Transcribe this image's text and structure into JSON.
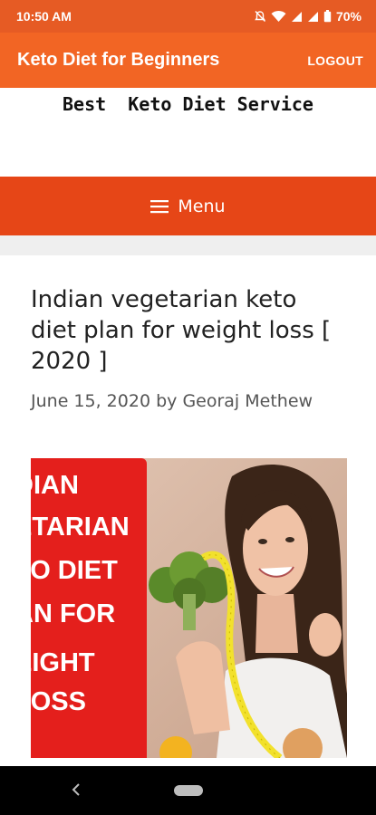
{
  "status_bar": {
    "time": "10:50 AM",
    "battery": "70%",
    "icons": [
      "mute-icon",
      "wifi-icon",
      "signal-icon",
      "signal-icon",
      "battery-icon"
    ]
  },
  "app_bar": {
    "title": "Keto Diet for Beginners",
    "logout_label": "LOGOUT",
    "color": "#f26524"
  },
  "site": {
    "title": "Best  Keto Diet Service",
    "menu_label": "Menu",
    "menu_color": "#e64617"
  },
  "article": {
    "title": "Indian vegetarian keto diet plan for weight loss [ 2020 ]",
    "date": "June 15, 2020",
    "by": "by",
    "author": "Georaj Methew"
  },
  "featured_image": {
    "text_lines": [
      "DIAN",
      "ETARIAN",
      "TO DIET",
      "AN FOR",
      "EIGHT",
      "LOSS"
    ],
    "panel_color": "#e41f1c"
  },
  "nav_bar": {
    "buttons": [
      "back-icon",
      "home-pill"
    ]
  }
}
